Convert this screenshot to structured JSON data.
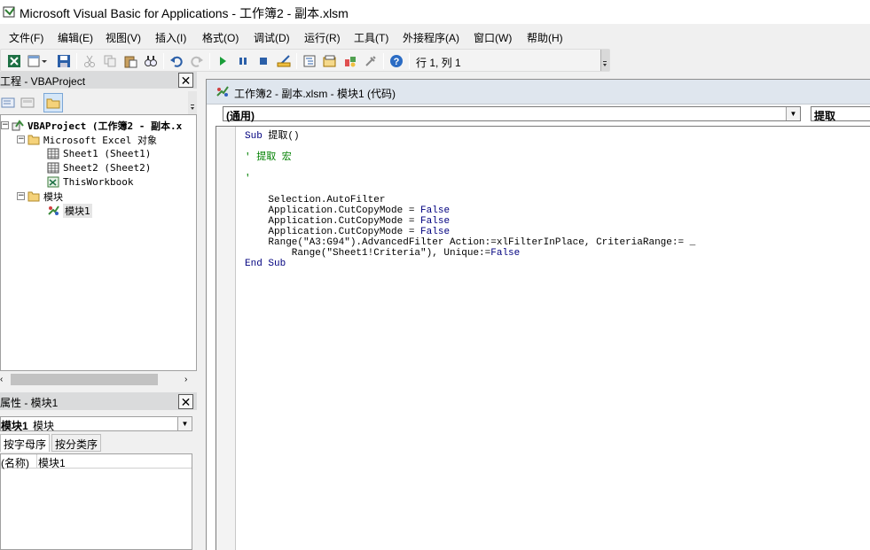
{
  "window": {
    "title": "Microsoft Visual Basic for Applications - 工作簿2 - 副本.xlsm"
  },
  "menu": {
    "items": [
      "文件(F)",
      "编辑(E)",
      "视图(V)",
      "插入(I)",
      "格式(O)",
      "调试(D)",
      "运行(R)",
      "工具(T)",
      "外接程序(A)",
      "窗口(W)",
      "帮助(H)"
    ]
  },
  "toolbar": {
    "position_label": "行 1, 列 1",
    "icons": [
      "excel-view-icon",
      "insert-object-icon",
      "save-icon",
      "cut-icon",
      "copy-icon",
      "paste-icon",
      "find-icon",
      "undo-icon",
      "redo-icon",
      "run-icon",
      "break-icon",
      "reset-icon",
      "design-mode-icon",
      "project-explorer-icon",
      "properties-icon",
      "object-browser-icon",
      "toolbox-icon",
      "help-icon"
    ]
  },
  "project": {
    "title": "工程 - VBAProject",
    "tree": {
      "root": "VBAProject (工作簿2 - 副本.x",
      "excel_objects": "Microsoft Excel 对象",
      "sheet1": "Sheet1 (Sheet1)",
      "sheet2": "Sheet2 (Sheet2)",
      "workbook": "ThisWorkbook",
      "modules": "模块",
      "module1": "模块1"
    }
  },
  "properties": {
    "title": "属性 - 模块1",
    "object_name": "模块1",
    "object_type": "模块",
    "tab_alpha": "按字母序",
    "tab_category": "按分类序",
    "row_name": "(名称)",
    "row_value": "模块1"
  },
  "code_window": {
    "title": "工作簿2 - 副本.xlsm - 模块1 (代码)",
    "object_combo": "(通用)",
    "procedure_combo": "提取",
    "lines": {
      "l1_kw": "Sub",
      "l1_rest": " 提取()",
      "l2": "' 提取 宏",
      "l3": "'",
      "l4": "    Selection.AutoFilter",
      "l5a": "    Application.CutCopyMode = ",
      "l6a": "    Application.CutCopyMode = ",
      "l7a": "    Application.CutCopyMode = ",
      "false_kw": "False",
      "l8": "    Range(\"A3:G94\").AdvancedFilter Action:=xlFilterInPlace, CriteriaRange:= _",
      "l9a": "        Range(\"Sheet1!Criteria\"), Unique:=",
      "end_sub": "End Sub"
    }
  },
  "colors": {
    "keyword": "#00007f",
    "comment": "#008000"
  }
}
